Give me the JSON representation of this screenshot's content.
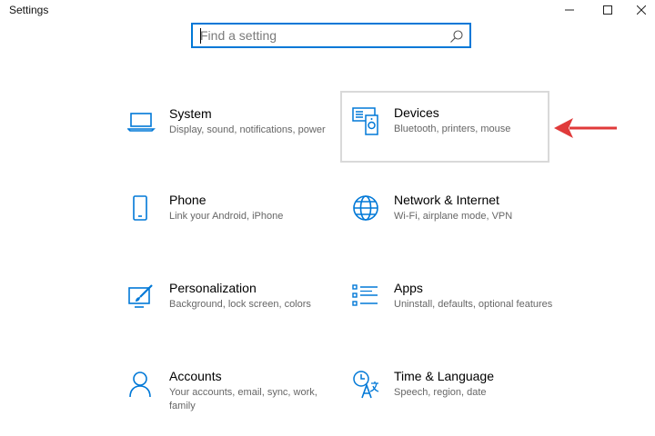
{
  "window": {
    "title": "Settings",
    "controls": {
      "minimize_icon": "minimize-icon",
      "maximize_icon": "maximize-icon",
      "close_icon": "close-icon"
    }
  },
  "search": {
    "placeholder": "Find a setting",
    "value": "",
    "icon": "search-icon"
  },
  "accent_color": "#0078d7",
  "annotation_color": "#e03a3a",
  "tiles": [
    {
      "title": "System",
      "description": "Display, sound, notifications, power",
      "icon": "laptop-icon"
    },
    {
      "title": "Devices",
      "description": "Bluetooth, printers, mouse",
      "icon": "devices-icon"
    },
    {
      "title": "Phone",
      "description": "Link your Android, iPhone",
      "icon": "phone-icon"
    },
    {
      "title": "Network & Internet",
      "description": "Wi-Fi, airplane mode, VPN",
      "icon": "globe-icon"
    },
    {
      "title": "Personalization",
      "description": "Background, lock screen, colors",
      "icon": "paint-icon"
    },
    {
      "title": "Apps",
      "description": "Uninstall, defaults, optional features",
      "icon": "apps-list-icon"
    },
    {
      "title": "Accounts",
      "description": "Your accounts, email, sync, work, family",
      "icon": "person-icon"
    },
    {
      "title": "Time & Language",
      "description": "Speech, region, date",
      "icon": "time-language-icon"
    }
  ],
  "annotation": {
    "icon": "red-arrow-icon",
    "points_to": "Devices"
  }
}
